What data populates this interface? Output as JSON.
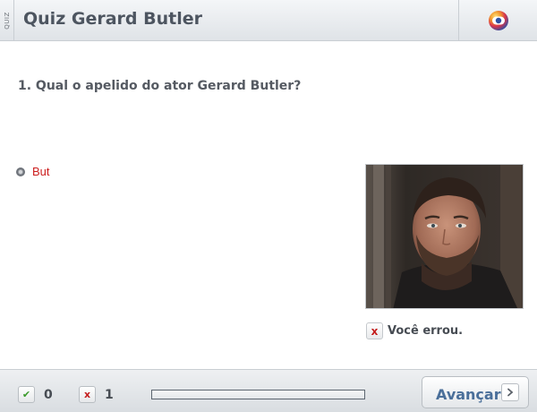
{
  "header": {
    "side_tab": "QUIZ",
    "title": "Quiz Gerard Butler",
    "logo_icon": "globo-logo-icon"
  },
  "question": {
    "text": "1. Qual o apelido do ator Gerard Butler?"
  },
  "answer": {
    "selected_label": "But",
    "color": "#cc1f1f"
  },
  "photo": {
    "icon": "actor-photo"
  },
  "feedback": {
    "icon": "x",
    "text": "Você errou."
  },
  "footer": {
    "correct_icon": "✔",
    "correct_count": "0",
    "wrong_icon": "x",
    "wrong_count": "1",
    "progress_fraction": 0.0,
    "advance_label": "Avançar",
    "advance_icon": "chevron-right-icon"
  }
}
